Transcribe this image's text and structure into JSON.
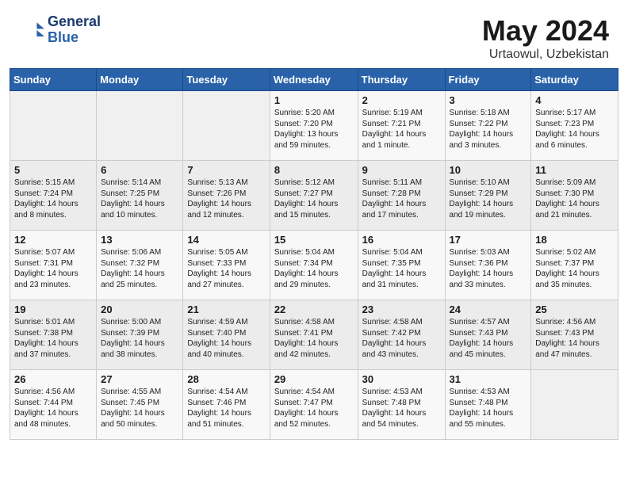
{
  "header": {
    "logo_line1": "General",
    "logo_line2": "Blue",
    "title": "May 2024",
    "subtitle": "Urtaowul, Uzbekistan"
  },
  "weekdays": [
    "Sunday",
    "Monday",
    "Tuesday",
    "Wednesday",
    "Thursday",
    "Friday",
    "Saturday"
  ],
  "weeks": [
    [
      {
        "day": "",
        "empty": true
      },
      {
        "day": "",
        "empty": true
      },
      {
        "day": "",
        "empty": true
      },
      {
        "day": "1",
        "sunrise": "5:20 AM",
        "sunset": "7:20 PM",
        "daylight": "13 hours and 59 minutes."
      },
      {
        "day": "2",
        "sunrise": "5:19 AM",
        "sunset": "7:21 PM",
        "daylight": "14 hours and 1 minute."
      },
      {
        "day": "3",
        "sunrise": "5:18 AM",
        "sunset": "7:22 PM",
        "daylight": "14 hours and 3 minutes."
      },
      {
        "day": "4",
        "sunrise": "5:17 AM",
        "sunset": "7:23 PM",
        "daylight": "14 hours and 6 minutes."
      }
    ],
    [
      {
        "day": "5",
        "sunrise": "5:15 AM",
        "sunset": "7:24 PM",
        "daylight": "14 hours and 8 minutes."
      },
      {
        "day": "6",
        "sunrise": "5:14 AM",
        "sunset": "7:25 PM",
        "daylight": "14 hours and 10 minutes."
      },
      {
        "day": "7",
        "sunrise": "5:13 AM",
        "sunset": "7:26 PM",
        "daylight": "14 hours and 12 minutes."
      },
      {
        "day": "8",
        "sunrise": "5:12 AM",
        "sunset": "7:27 PM",
        "daylight": "14 hours and 15 minutes."
      },
      {
        "day": "9",
        "sunrise": "5:11 AM",
        "sunset": "7:28 PM",
        "daylight": "14 hours and 17 minutes."
      },
      {
        "day": "10",
        "sunrise": "5:10 AM",
        "sunset": "7:29 PM",
        "daylight": "14 hours and 19 minutes."
      },
      {
        "day": "11",
        "sunrise": "5:09 AM",
        "sunset": "7:30 PM",
        "daylight": "14 hours and 21 minutes."
      }
    ],
    [
      {
        "day": "12",
        "sunrise": "5:07 AM",
        "sunset": "7:31 PM",
        "daylight": "14 hours and 23 minutes."
      },
      {
        "day": "13",
        "sunrise": "5:06 AM",
        "sunset": "7:32 PM",
        "daylight": "14 hours and 25 minutes."
      },
      {
        "day": "14",
        "sunrise": "5:05 AM",
        "sunset": "7:33 PM",
        "daylight": "14 hours and 27 minutes."
      },
      {
        "day": "15",
        "sunrise": "5:04 AM",
        "sunset": "7:34 PM",
        "daylight": "14 hours and 29 minutes."
      },
      {
        "day": "16",
        "sunrise": "5:04 AM",
        "sunset": "7:35 PM",
        "daylight": "14 hours and 31 minutes."
      },
      {
        "day": "17",
        "sunrise": "5:03 AM",
        "sunset": "7:36 PM",
        "daylight": "14 hours and 33 minutes."
      },
      {
        "day": "18",
        "sunrise": "5:02 AM",
        "sunset": "7:37 PM",
        "daylight": "14 hours and 35 minutes."
      }
    ],
    [
      {
        "day": "19",
        "sunrise": "5:01 AM",
        "sunset": "7:38 PM",
        "daylight": "14 hours and 37 minutes."
      },
      {
        "day": "20",
        "sunrise": "5:00 AM",
        "sunset": "7:39 PM",
        "daylight": "14 hours and 38 minutes."
      },
      {
        "day": "21",
        "sunrise": "4:59 AM",
        "sunset": "7:40 PM",
        "daylight": "14 hours and 40 minutes."
      },
      {
        "day": "22",
        "sunrise": "4:58 AM",
        "sunset": "7:41 PM",
        "daylight": "14 hours and 42 minutes."
      },
      {
        "day": "23",
        "sunrise": "4:58 AM",
        "sunset": "7:42 PM",
        "daylight": "14 hours and 43 minutes."
      },
      {
        "day": "24",
        "sunrise": "4:57 AM",
        "sunset": "7:43 PM",
        "daylight": "14 hours and 45 minutes."
      },
      {
        "day": "25",
        "sunrise": "4:56 AM",
        "sunset": "7:43 PM",
        "daylight": "14 hours and 47 minutes."
      }
    ],
    [
      {
        "day": "26",
        "sunrise": "4:56 AM",
        "sunset": "7:44 PM",
        "daylight": "14 hours and 48 minutes."
      },
      {
        "day": "27",
        "sunrise": "4:55 AM",
        "sunset": "7:45 PM",
        "daylight": "14 hours and 50 minutes."
      },
      {
        "day": "28",
        "sunrise": "4:54 AM",
        "sunset": "7:46 PM",
        "daylight": "14 hours and 51 minutes."
      },
      {
        "day": "29",
        "sunrise": "4:54 AM",
        "sunset": "7:47 PM",
        "daylight": "14 hours and 52 minutes."
      },
      {
        "day": "30",
        "sunrise": "4:53 AM",
        "sunset": "7:48 PM",
        "daylight": "14 hours and 54 minutes."
      },
      {
        "day": "31",
        "sunrise": "4:53 AM",
        "sunset": "7:48 PM",
        "daylight": "14 hours and 55 minutes."
      },
      {
        "day": "",
        "empty": true
      }
    ]
  ],
  "labels": {
    "sunrise": "Sunrise:",
    "sunset": "Sunset:",
    "daylight": "Daylight hours"
  }
}
